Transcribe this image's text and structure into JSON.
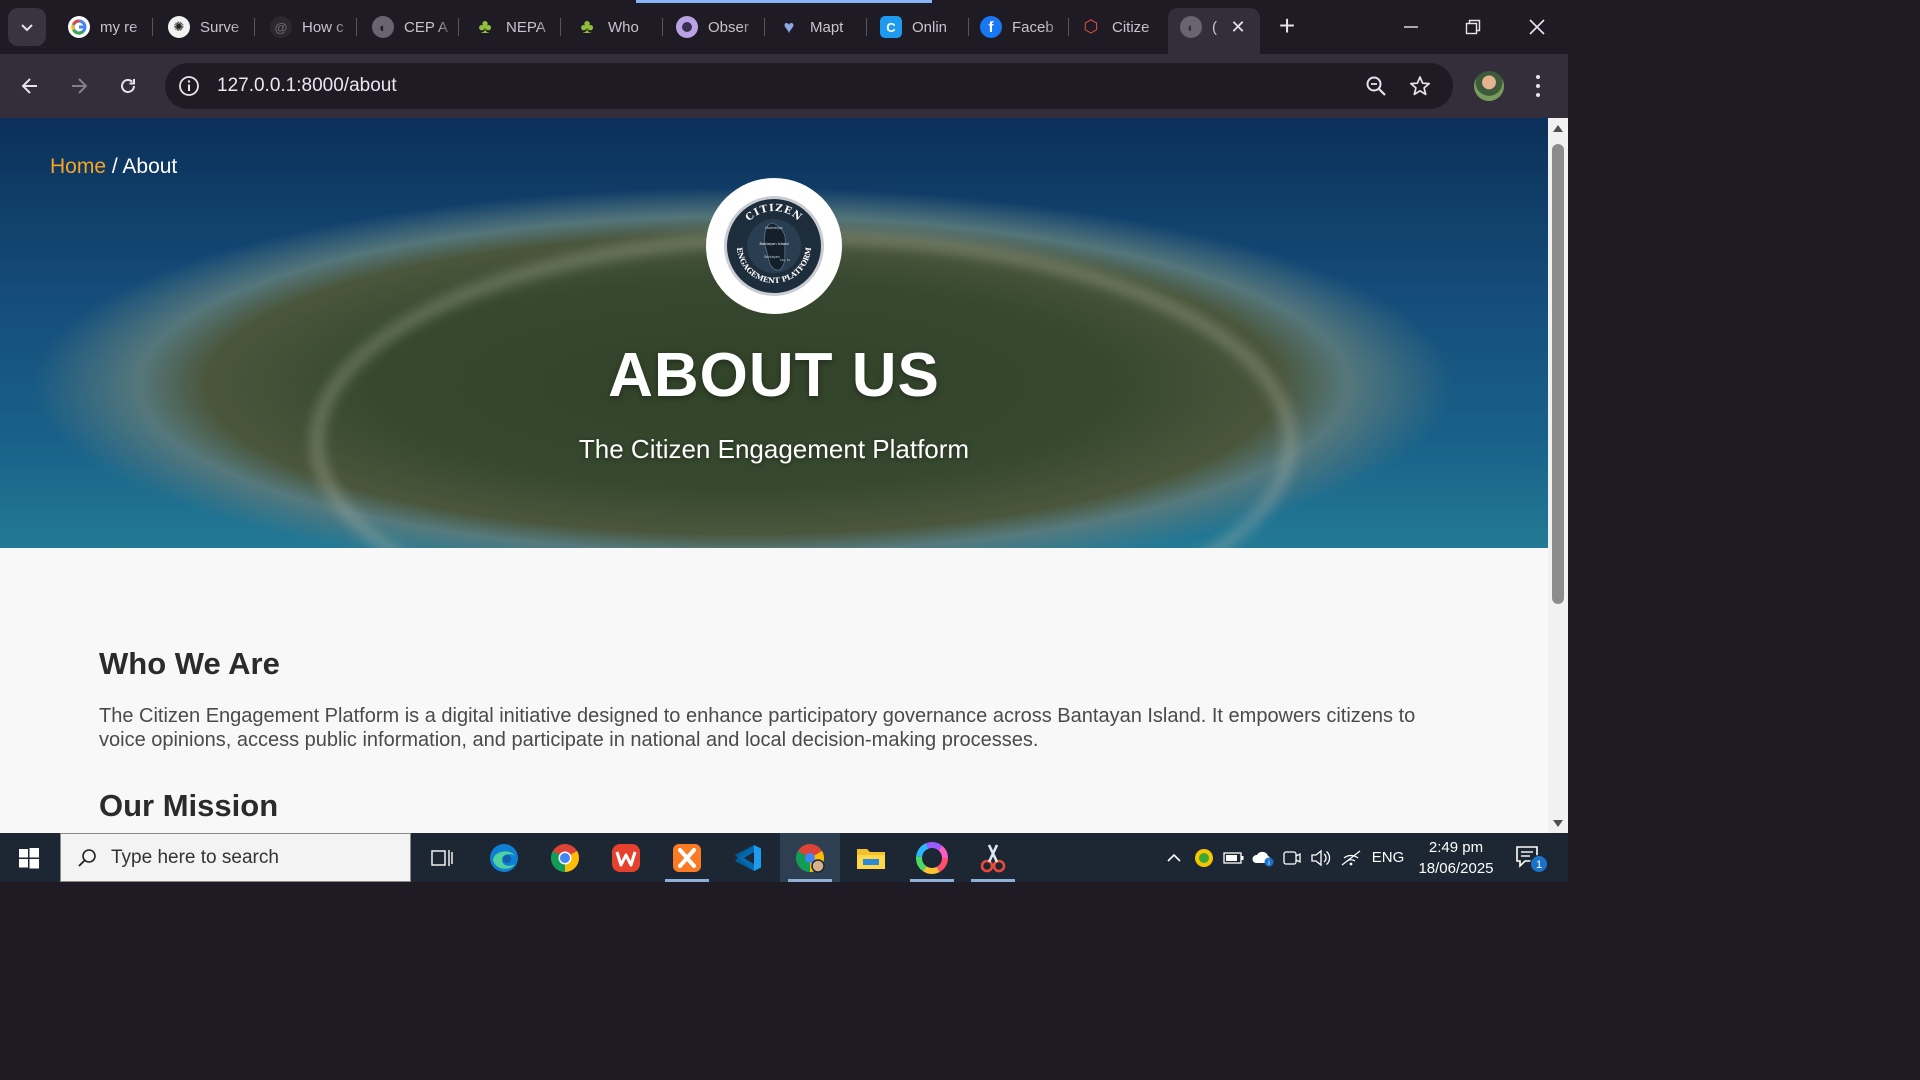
{
  "browser": {
    "tabs": [
      {
        "title": "my re",
        "favicon": "google-icon",
        "color": "#4285f4"
      },
      {
        "title": "Surve",
        "favicon": "openai-icon",
        "color": "#e8e8e8"
      },
      {
        "title": "How c",
        "favicon": "threads-icon",
        "color": "#5a5a5a"
      },
      {
        "title": "CEP A",
        "favicon": "globe-icon",
        "color": "#9a94a0"
      },
      {
        "title": "NEPA",
        "favicon": "africa-icon",
        "color": "#8fbf3a"
      },
      {
        "title": "Who",
        "favicon": "africa-icon",
        "color": "#8fbf3a"
      },
      {
        "title": "Obser",
        "favicon": "observable-icon",
        "color": "#b9a3e3"
      },
      {
        "title": "Mapt",
        "favicon": "maptiler-icon",
        "color": "#4b7bd8"
      },
      {
        "title": "Onlin",
        "favicon": "c-icon",
        "color": "#1e9bf0"
      },
      {
        "title": "Faceb",
        "favicon": "facebook-icon",
        "color": "#1877f2"
      },
      {
        "title": "Citize",
        "favicon": "laravel-icon",
        "color": "#f05340"
      },
      {
        "title": "(",
        "favicon": "globe-icon",
        "color": "#9a94a0"
      }
    ],
    "new_tab_label": "+",
    "url": "127.0.0.1:8000/about"
  },
  "page": {
    "breadcrumb": {
      "home": "Home",
      "separator": " / ",
      "current": "About"
    },
    "logo": {
      "ring_top": "CITIZEN",
      "ring_bottom": "ENGAGEMENT PLATFORM",
      "map_labels": [
        "Madridejos",
        "Bantayan Island",
        "Bantayan",
        "Sta. Fe"
      ]
    },
    "hero_title": "ABOUT US",
    "hero_subtitle": "The Citizen Engagement Platform",
    "sections": [
      {
        "heading": "Who We Are",
        "body": "The Citizen Engagement Platform is a digital initiative designed to enhance participatory governance across Bantayan Island. It empowers citizens to voice opinions, access public information, and participate in national and local decision-making processes."
      },
      {
        "heading": "Our Mission"
      }
    ],
    "accent_color": "#f5a623"
  },
  "taskbar": {
    "search_placeholder": "Type here to search",
    "tray": {
      "language": "ENG",
      "notifications": "1"
    },
    "time": "2:49 pm",
    "date": "18/06/2025"
  }
}
